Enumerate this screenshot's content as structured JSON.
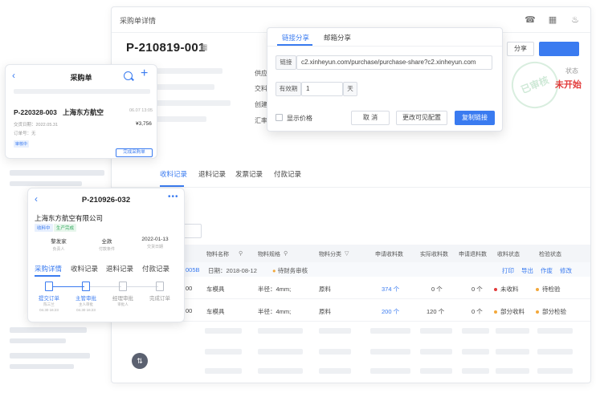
{
  "window": {
    "title": "采购单详情",
    "order_no": "P-210819-001",
    "qr_icon": "qr-code-icon",
    "fields": [
      "供应",
      "交料",
      "创建",
      "汇率"
    ],
    "share_label": "分享",
    "status_label": "状态",
    "status_value": "未开始",
    "stamp_text": "已审核",
    "tabs": [
      "收料记录",
      "退料记录",
      "发票记录",
      "付款记录"
    ],
    "table": {
      "headers": [
        "物料名称",
        "物料规格",
        "物料分类",
        "申请收料数",
        "实际收料数",
        "申请退料数",
        "收料状态",
        "检验状态"
      ],
      "group": {
        "id": "005B",
        "date": "日期：2018-08-12",
        "pending": "待财务审核",
        "actions": [
          "打印",
          "导出",
          "作废",
          "修改"
        ]
      },
      "rows": [
        {
          "code": "00",
          "name": "车模具",
          "spec": "半径：4mm;",
          "category": "原料",
          "apply": "374 个",
          "actual": "0 个",
          "returned": "0 个",
          "receive_status": "未收料",
          "inspect_status": "待检验"
        },
        {
          "code": "00",
          "name": "车模具",
          "spec": "半径：4mm;",
          "category": "原料",
          "apply": "200 个",
          "actual": "120 个",
          "returned": "0 个",
          "receive_status": "部分收料",
          "inspect_status": "部分检验"
        }
      ]
    },
    "colors": {
      "accent": "#3a7bf0",
      "danger": "#e23b3b",
      "warning": "#f2a83b"
    }
  },
  "share_popup": {
    "tabs": [
      "链接分享",
      "邮箱分享"
    ],
    "link_label": "链接",
    "link_value": "c2.xinheyun.com/purchase/purchase-share?c2.xinheyun.com",
    "validity_label": "有效期",
    "validity_value": "1",
    "validity_unit": "天",
    "show_price": "显示价格",
    "cancel": "取 消",
    "change_config": "更改可见配置",
    "copy_link": "复制链接"
  },
  "mobile_list": {
    "title": "采购单",
    "order_no": "P-220328-003",
    "company": "上海东方航空",
    "time": "06.07 13:05",
    "date_line": "交货日期：2022.05.31",
    "order_type": "订单号：无",
    "amount": "¥3,756",
    "badge": "审核中",
    "action": "完成采购单"
  },
  "mobile_detail": {
    "order_no": "P-210926-032",
    "company": "上海东方航空有限公司",
    "chips": [
      "收料中",
      "生产完成"
    ],
    "info": [
      {
        "value": "黎发家",
        "key": "负责人"
      },
      {
        "value": "全款",
        "key": "付款条件"
      },
      {
        "value": "2022-01-13",
        "key": "交货日期"
      }
    ],
    "tabs": [
      "采购详情",
      "收料记录",
      "退料记录",
      "付款记录"
    ],
    "steps": [
      {
        "label": "提交订单",
        "sub": "陈三兰\n04.30 16:23"
      },
      {
        "label": "主管审批",
        "sub": "主人审批 · 04.30 16:23"
      },
      {
        "label": "经理审批",
        "sub": "审批人"
      },
      {
        "label": "完成订单",
        "sub": ""
      }
    ],
    "step1_sub1": "陈三兰",
    "step1_sub2": "04.30 16:23",
    "step2_sub1": "主人审批",
    "step2_sub2": "04.30 16:23",
    "step3_sub1": "审批人"
  }
}
